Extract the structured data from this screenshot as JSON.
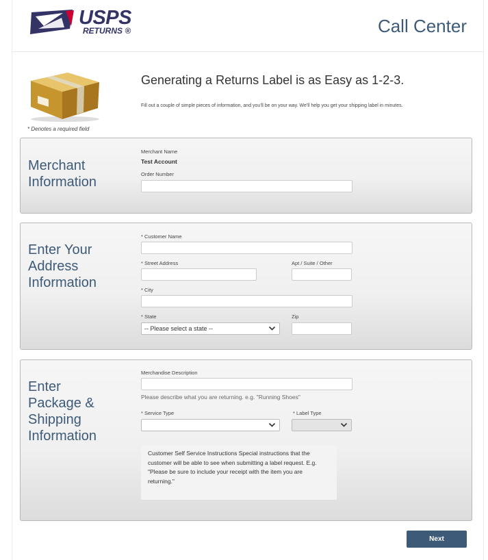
{
  "header": {
    "logo_main": "USPS",
    "logo_sub": "RETURNS ®",
    "title": "Call Center"
  },
  "intro": {
    "headline": "Generating a Returns Label is as Easy as 1-2-3.",
    "subtext": "Fill out a couple of simple pieces of information, and you'll be on your way. We'll help you get your shipping label in minutes.",
    "required_note": "* Denotes a required field"
  },
  "merchant": {
    "title_line1": "Merchant",
    "title_line2": "Information",
    "merchant_name_label": "Merchant Name",
    "merchant_name_value": "Test Account",
    "order_number_label": "Order Number",
    "order_number_value": ""
  },
  "address": {
    "title_line1": "Enter Your",
    "title_line2": "Address",
    "title_line3": "Information",
    "customer_name_label": "* Customer Name",
    "customer_name_value": "",
    "street_label": "* Street Address",
    "street_value": "",
    "apt_label": "Apt / Suite / Other",
    "apt_value": "",
    "city_label": "* City",
    "city_value": "",
    "state_label": "* State",
    "state_selected": "-- Please select a state --",
    "zip_label": "Zip",
    "zip_value": ""
  },
  "package": {
    "title_line1": "Enter",
    "title_line2": "Package &",
    "title_line3": "Shipping",
    "title_line4": "Information",
    "description_label": "Merchandise Description",
    "description_value": "",
    "description_hint": "Please describe what you are returning. e.g. \"Running Shoes\"",
    "service_type_label": "* Service Type",
    "service_type_selected": "",
    "label_type_label": "* Label Type",
    "label_type_selected": "",
    "instructions": "Customer Self Service Instructions Special instructions that the customer will be able to see when submitting a label request. E.g. \"Please be sure to include your receipt with the item you are returning.\""
  },
  "footer": {
    "next_label": "Next"
  },
  "colors": {
    "accent": "#3d5a78",
    "logo_blue": "#333366",
    "logo_red": "#cc0033"
  }
}
